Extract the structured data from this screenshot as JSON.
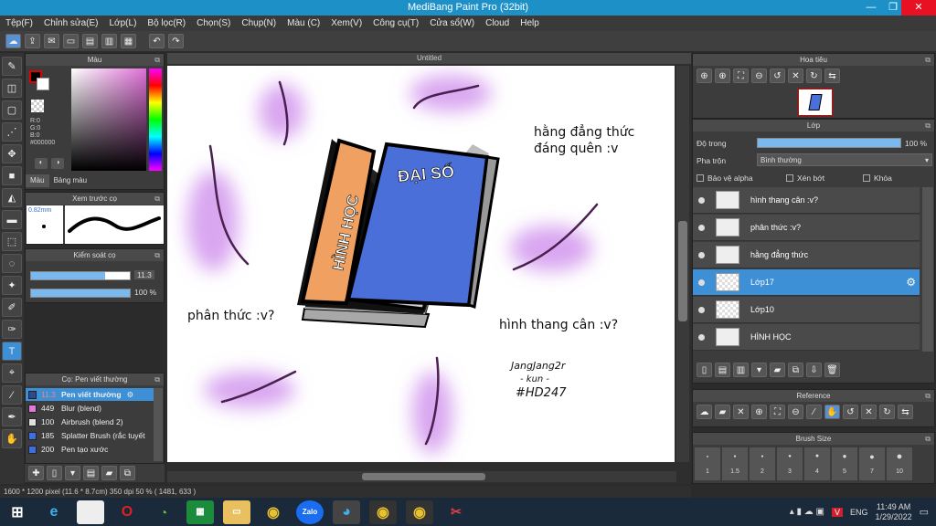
{
  "window": {
    "title": "MediBang Paint Pro (32bit)"
  },
  "menu": [
    "Tệp(F)",
    "Chỉnh sửa(E)",
    "Lớp(L)",
    "Bộ lọc(R)",
    "Chọn(S)",
    "Chụp(N)",
    "Màu (C)",
    "Xem(V)",
    "Công cụ(T)",
    "Cửa sổ(W)",
    "Cloud",
    "Help"
  ],
  "canvas": {
    "title": "Untitled"
  },
  "color_panel": {
    "title": "Màu",
    "r": "R:0",
    "g": "G:0",
    "b": "B:0",
    "hex": "#000000",
    "tab_color": "Màu",
    "tab_palette": "Bảng màu"
  },
  "brush_preview": {
    "title": "Xem trước cọ",
    "size": "0.82mm"
  },
  "brush_control": {
    "title": "Kiểm soát cọ",
    "size": "11.3",
    "opacity": "100 %",
    "size_level": 0.75,
    "opacity_level": 1.0
  },
  "brush_list": {
    "title": "Cọ: Pen viết thường",
    "items": [
      {
        "size": "11.3",
        "name": "Pen viết thường",
        "color": "#2a4c8c"
      },
      {
        "size": "449",
        "name": "Blur (blend)",
        "color": "#e07ad8"
      },
      {
        "size": "100",
        "name": "Airbrush (blend 2)",
        "color": "#e0e0e0"
      },
      {
        "size": "185",
        "name": "Splatter Brush (rắc tuyết",
        "color": "#3d6fe0"
      },
      {
        "size": "200",
        "name": "Pen tạo xước",
        "color": "#3d6fe0"
      }
    ]
  },
  "navigator": {
    "title": "Hoa tiêu"
  },
  "layers": {
    "title": "Lớp",
    "opacity_label": "Độ trong",
    "opacity_value": "100 %",
    "opacity_level": 1.0,
    "blend_label": "Pha trộn",
    "blend_value": "Bình thường",
    "protect_alpha": "Bảo vệ alpha",
    "clipping": "Xén bớt",
    "lock": "Khóa",
    "items": [
      {
        "name": "hình thang cân :v?"
      },
      {
        "name": "phân thức :v?"
      },
      {
        "name": "hằng đẳng thức"
      },
      {
        "name": "Lớp17"
      },
      {
        "name": "Lớp10"
      },
      {
        "name": "HÌNH HỌC"
      }
    ],
    "selected_index": 3
  },
  "reference": {
    "title": "Reference"
  },
  "brush_size": {
    "title": "Brush Size",
    "values": [
      "1",
      "1.5",
      "2",
      "3",
      "4",
      "5",
      "7",
      "10"
    ]
  },
  "artwork": {
    "book_front_title": "ĐẠI SỐ",
    "book_back_title": "HÌNH HỌC",
    "text_top_right_1": "hằng đẳng thức",
    "text_top_right_2": "đáng quên :v",
    "text_left": "phân thức :v?",
    "text_right": "hình thang cân :v?",
    "signature_1": "JangJang2r",
    "signature_2": "- kun -",
    "signature_3": "#HD247"
  },
  "status": {
    "text": "1600 * 1200 pixel   (11.6 * 8.7cm)   350 dpi   50 %   ( 1481, 633 )"
  },
  "taskbar": {
    "lang": "ENG",
    "time": "11:49 AM",
    "date": "1/29/2022"
  },
  "colors": {
    "accent": "#3d8fd6",
    "title_bar": "#1e90c8",
    "close": "#e81123"
  }
}
